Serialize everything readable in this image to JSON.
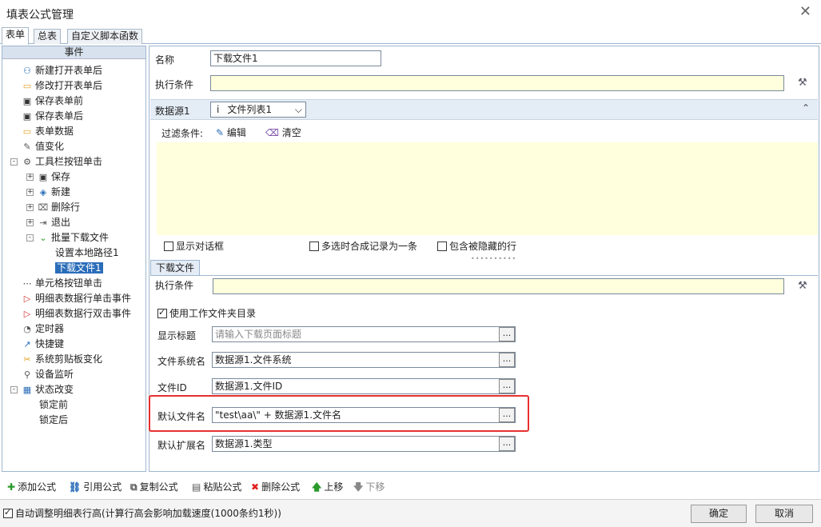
{
  "window": {
    "title": "填表公式管理"
  },
  "tabs": [
    "表单",
    "总表",
    "自定义脚本函数"
  ],
  "tree": {
    "header": "事件",
    "items": [
      {
        "label": "新建打开表单后",
        "icon": "user-add-icon"
      },
      {
        "label": "修改打开表单后",
        "icon": "folder-icon"
      },
      {
        "label": "保存表单前",
        "icon": "save-icon"
      },
      {
        "label": "保存表单后",
        "icon": "save-icon"
      },
      {
        "label": "表单数据",
        "icon": "folder-icon"
      },
      {
        "label": "值变化",
        "icon": "edit-icon"
      },
      {
        "label": "工具栏按钮单击",
        "icon": "wrench-icon"
      },
      {
        "label": "保存",
        "icon": "save-icon"
      },
      {
        "label": "新建",
        "icon": "shield-icon"
      },
      {
        "label": "删除行",
        "icon": "delete-row-icon"
      },
      {
        "label": "退出",
        "icon": "exit-icon"
      },
      {
        "label": "批量下载文件",
        "icon": "download-icon"
      },
      {
        "label": "设置本地路径1",
        "icon": ""
      },
      {
        "label": "下载文件1",
        "icon": ""
      },
      {
        "label": "单元格按钮单击",
        "icon": "ellipsis-icon"
      },
      {
        "label": "明细表数据行单击事件",
        "icon": "flag-icon"
      },
      {
        "label": "明细表数据行双击事件",
        "icon": "flag-icon"
      },
      {
        "label": "定时器",
        "icon": "timer-icon"
      },
      {
        "label": "快捷键",
        "icon": "shortcut-icon"
      },
      {
        "label": "系统剪贴板变化",
        "icon": "scissors-icon"
      },
      {
        "label": "设备监听",
        "icon": "device-icon"
      },
      {
        "label": "状态改变",
        "icon": "state-icon"
      },
      {
        "label": "锁定前",
        "icon": ""
      },
      {
        "label": "锁定后",
        "icon": ""
      }
    ]
  },
  "form": {
    "name_label": "名称",
    "name_value": "下载文件1",
    "exec_label": "执行条件",
    "datasource_label": "数据源1",
    "datasource_prefix": "i",
    "datasource_value": "文件列表1",
    "filter_label": "过滤条件:",
    "edit_label": "编辑",
    "clear_label": "清空",
    "show_dialog": "显示对话框",
    "merge_records": "多选时合成记录为一条",
    "include_hidden": "包含被隐藏的行"
  },
  "download": {
    "tab_label": "下载文件",
    "exec_label": "执行条件",
    "use_workdir": "使用工作文件夹目录",
    "fields": [
      {
        "label": "显示标题",
        "value": "请输入下载页面标题",
        "placeholder": true
      },
      {
        "label": "文件系统名",
        "value": "数据源1.文件系统"
      },
      {
        "label": "文件ID",
        "value": "数据源1.文件ID"
      },
      {
        "label": "默认文件名",
        "value": "\"test\\aa\\\"  + 数据源1.文件名"
      },
      {
        "label": "默认扩展名",
        "value": "数据源1.类型"
      }
    ],
    "dots": "..."
  },
  "toolbar": {
    "add": "添加公式",
    "ref": "引用公式",
    "copy": "复制公式",
    "paste": "粘贴公式",
    "delete": "删除公式",
    "up": "上移",
    "down": "下移"
  },
  "footer": {
    "auto_adjust": "自动调整明细表行高(计算行高会影响加载速度(1000条约1秒))",
    "ok": "确定",
    "cancel": "取消"
  }
}
